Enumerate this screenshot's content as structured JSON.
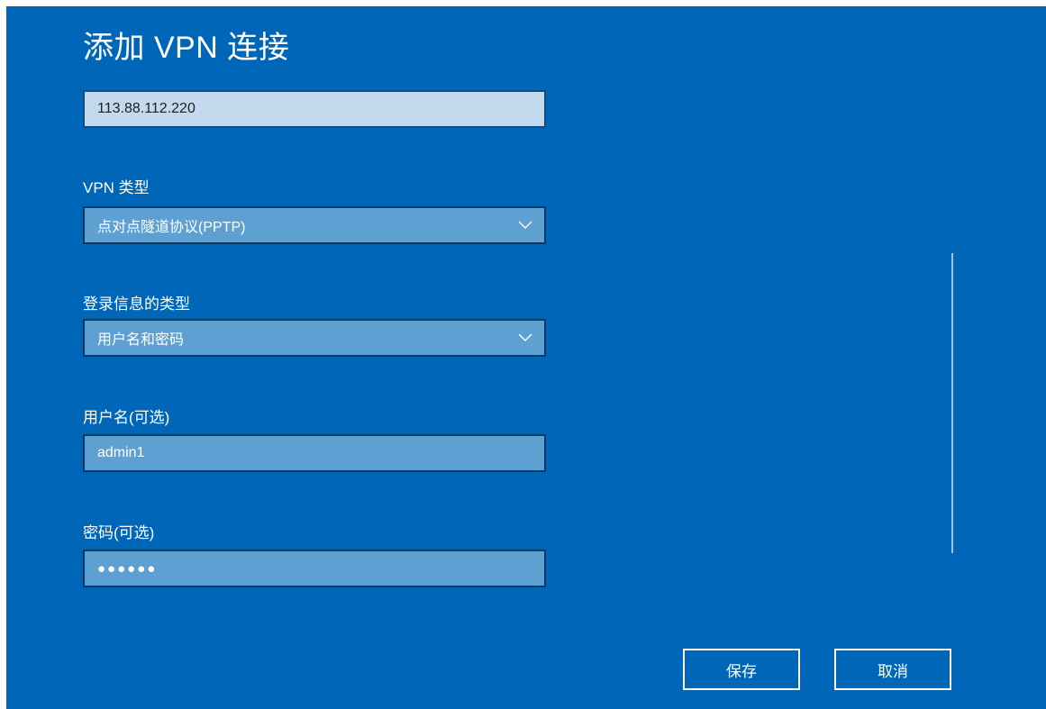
{
  "dialog": {
    "title": "添加 VPN 连接",
    "colors": {
      "background": "#0067b8",
      "field_fill": "#5fa0d3",
      "server_field_fill": "#c3daee",
      "field_border": "#0b3a66",
      "text": "#ffffff"
    }
  },
  "server_field": {
    "value": "113.88.112.220"
  },
  "vpn_type": {
    "label": "VPN 类型",
    "selected": "点对点隧道协议(PPTP)",
    "icon": "chevron-down-icon"
  },
  "signin_type": {
    "label": "登录信息的类型",
    "selected": "用户名和密码",
    "icon": "chevron-down-icon"
  },
  "username": {
    "label": "用户名(可选)",
    "value": "admin1"
  },
  "password": {
    "label": "密码(可选)",
    "value": "●●●●●●"
  },
  "buttons": {
    "save_label": "保存",
    "cancel_label": "取消"
  }
}
